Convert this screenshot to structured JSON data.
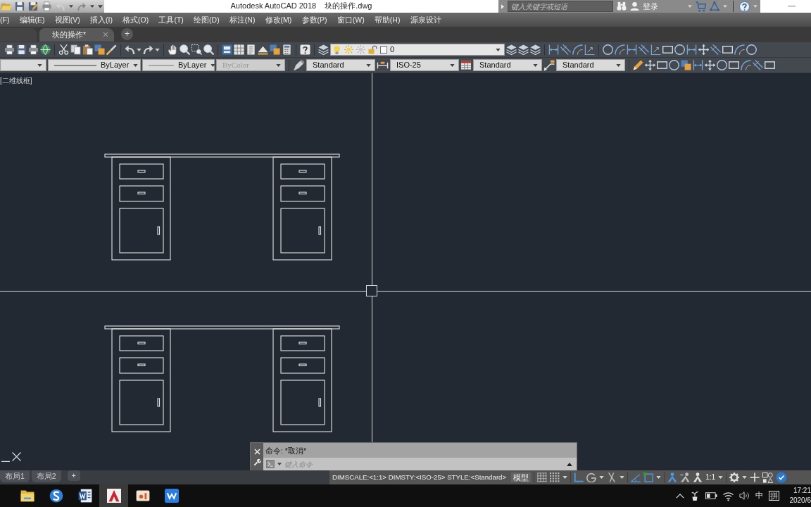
{
  "title_bar": {
    "app_title": "Autodesk AutoCAD 2018",
    "file_name": "块的操作.dwg",
    "search": {
      "placeholder": "键入关键字或短语"
    },
    "sign_in": "登录"
  },
  "menu_bar": [
    "(F)",
    "编辑(E)",
    "视图(V)",
    "插入(I)",
    "格式(O)",
    "工具(T)",
    "绘图(D)",
    "标注(N)",
    "修改(M)",
    "参数(P)",
    "窗口(W)",
    "帮助(H)",
    "源泉设计"
  ],
  "file_tabs": [
    {
      "label": "块的操作*",
      "selected": true
    }
  ],
  "new_tab_button": "+",
  "layer_control": {
    "value": "0"
  },
  "properties_bar": {
    "linetype": "ByLayer",
    "lineweight": "ByLayer",
    "plot_style": {
      "value": "ByColor",
      "disabled": true
    },
    "text_style": "Standard",
    "dim_style": "ISO-25",
    "table_style": "Standard",
    "multileader_style": "Standard"
  },
  "viewport": {
    "label": "[二维线框]"
  },
  "command_line": {
    "history": "命令: *取消*",
    "placeholder": "键入命令"
  },
  "layout_tabs": [
    {
      "label": "布局1",
      "selected": false
    },
    {
      "label": "布局2",
      "selected": false
    }
  ],
  "add_layout_button": "+",
  "status_bar": {
    "dim_info": "DIMSCALE:<1:1> DIMSTY:<ISO-25> STYLE:<Standard>",
    "space": "模型",
    "toggles": [
      {
        "kind": "grid",
        "on": false
      },
      {
        "kind": "snap",
        "on": false
      },
      {
        "kind": "ortho",
        "on": true
      },
      {
        "kind": "polar",
        "on": false
      },
      {
        "kind": "isodraft",
        "on": false
      },
      {
        "kind": "otrack",
        "on": true
      },
      {
        "kind": "osnap",
        "on": true
      },
      {
        "kind": "annovis",
        "on": true
      },
      {
        "kind": "autoscale",
        "on": false
      }
    ],
    "annotation_scale": "1:1",
    "hardware_acceleration": {
      "on": true
    }
  },
  "taskbar": {
    "apps": [
      {
        "kind": "folder",
        "selected": false
      },
      {
        "kind": "browser",
        "selected": false
      },
      {
        "kind": "word",
        "selected": false
      },
      {
        "kind": "autocad",
        "selected": true
      },
      {
        "kind": "media",
        "selected": false
      },
      {
        "kind": "wps",
        "selected": false
      }
    ],
    "ime_mode": "中",
    "ime": "拼",
    "time": "17:21",
    "date": "2020/6"
  }
}
